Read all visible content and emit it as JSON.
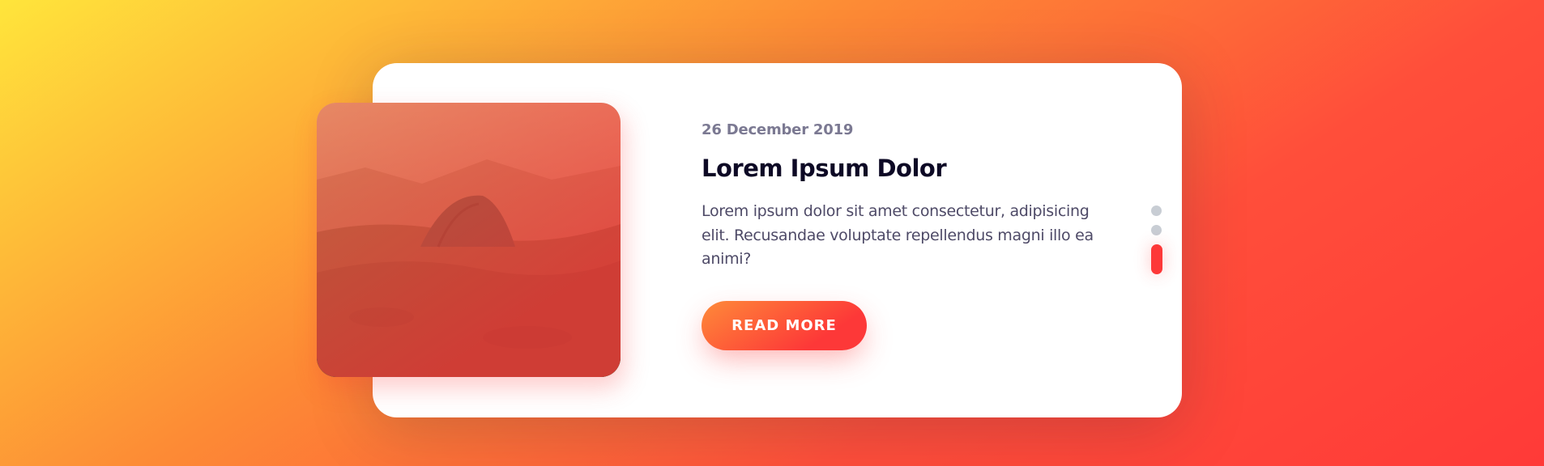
{
  "slider": {
    "date": "26 December 2019",
    "title": "Lorem Ipsum Dolor",
    "text": "Lorem ipsum dolor sit amet consectetur, adipisicing elit. Recusandae voluptate repellendus magni illo ea animi?",
    "button_label": "READ MORE",
    "image_icon": "tent-photo",
    "pagination": {
      "count": 3,
      "active_index": 2
    }
  },
  "colors": {
    "accent": "#fd3838",
    "accent_light": "#fe8a39",
    "title": "#0d0925",
    "date": "#7b7992",
    "body_text": "#4e4a67",
    "bullet_inactive": "#c8cdd4"
  }
}
